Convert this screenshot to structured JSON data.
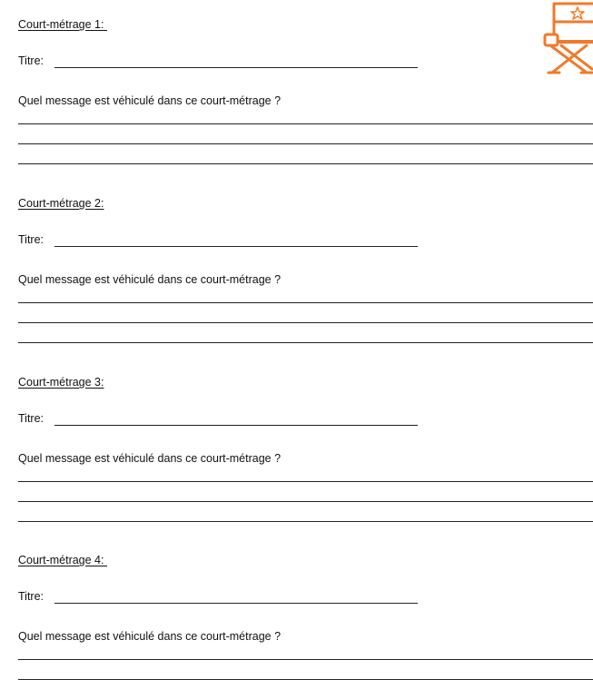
{
  "document": {
    "sections": [
      {
        "heading": "Court-métrage 1: ",
        "title_label": "Titre:",
        "question": "Quel message est véhiculé dans ce court-métrage ?"
      },
      {
        "heading": "Court-métrage 2:",
        "title_label": "Titre:",
        "question": "Quel message est véhiculé dans ce court-métrage ?"
      },
      {
        "heading": "Court-métrage 3:",
        "title_label": "Titre:",
        "question": "Quel message est véhiculé dans ce court-métrage ?"
      },
      {
        "heading": "Court-métrage 4: ",
        "title_label": "Titre:",
        "question": "Quel message est véhiculé dans ce court-métrage ?"
      }
    ]
  },
  "logo": {
    "icon": "director-chair-icon",
    "color": "#f07a2a"
  }
}
